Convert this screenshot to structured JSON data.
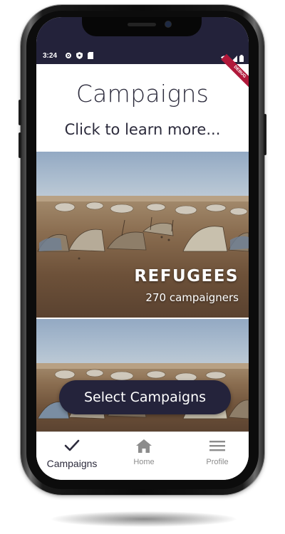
{
  "status_bar": {
    "time": "3:24"
  },
  "header": {
    "title": "Campaigns",
    "subtitle": "Click to learn more..."
  },
  "debug_banner": "DEBUG",
  "campaigns": [
    {
      "title": "REFUGEES",
      "subtitle": "270 campaigners"
    },
    {
      "title": "",
      "subtitle": ""
    }
  ],
  "select_button": {
    "label": "Select Campaigns"
  },
  "bottom_nav": {
    "items": [
      {
        "label": "Campaigns",
        "icon": "check-icon",
        "active": true
      },
      {
        "label": "Home",
        "icon": "home-icon",
        "active": false
      },
      {
        "label": "Profile",
        "icon": "menu-icon",
        "active": false
      }
    ]
  },
  "colors": {
    "primary": "#23223a",
    "text": "#2c2b3c",
    "inactive": "#8c8c8c"
  }
}
